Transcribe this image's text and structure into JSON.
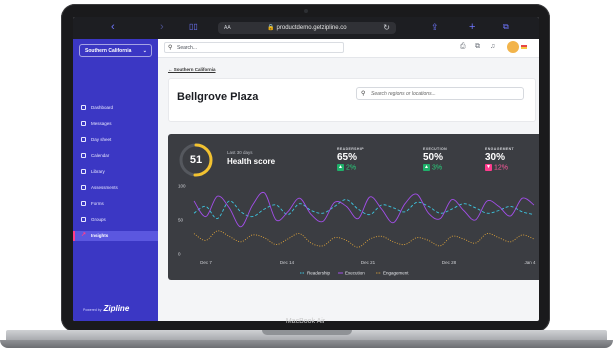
{
  "device": {
    "label": "MacBook Air"
  },
  "browser": {
    "url": "productdemo.getzipline.co",
    "aa": "AA"
  },
  "sidebar": {
    "region": "Southern California",
    "items": [
      {
        "label": "Dashboard",
        "icon": "dashboard-icon"
      },
      {
        "label": "Messages",
        "icon": "messages-icon"
      },
      {
        "label": "Day sheet",
        "icon": "day-sheet-icon"
      },
      {
        "label": "Calendar",
        "icon": "calendar-icon"
      },
      {
        "label": "Library",
        "icon": "library-icon"
      },
      {
        "label": "Assessments",
        "icon": "assessments-icon"
      },
      {
        "label": "Forms",
        "icon": "forms-icon"
      },
      {
        "label": "Groups",
        "icon": "groups-icon"
      },
      {
        "label": "Insights",
        "icon": "insights-icon"
      }
    ],
    "active_item": "Insights",
    "powered_by": "Powered by",
    "brand": "Zipline"
  },
  "toolbar": {
    "search_placeholder": "Search..."
  },
  "breadcrumb": "← Southern California",
  "page": {
    "title": "Bellgrove Plaza",
    "region_search_placeholder": "Search regions or locations..."
  },
  "scorecard": {
    "score": "51",
    "period": "Last 30 days",
    "label": "Health score",
    "score_fraction": 0.51,
    "metrics": [
      {
        "label": "READERSHIP",
        "value": "65%",
        "delta": "2%",
        "direction": "up",
        "color": "#1fb06a"
      },
      {
        "label": "EXECUTION",
        "value": "50%",
        "delta": "3%",
        "direction": "up",
        "color": "#1fb06a"
      },
      {
        "label": "ENGAGEMENT",
        "value": "30%",
        "delta": "12%",
        "direction": "down",
        "color": "#ff3b8d"
      }
    ]
  },
  "chart_data": {
    "type": "line",
    "ylim": [
      0,
      100
    ],
    "y_ticks": [
      "100",
      "50",
      "0"
    ],
    "x_ticks": [
      "Dec 7",
      "Dec 14",
      "Dec 21",
      "Dec 28",
      "Jan 4"
    ],
    "series": [
      {
        "name": "Readership",
        "color": "#3dc6e0",
        "style": "dashed",
        "values": [
          60,
          70,
          52,
          78,
          62,
          55,
          66,
          72,
          58,
          74,
          64,
          60,
          70,
          80,
          66,
          58,
          72,
          68,
          62,
          76,
          70,
          60,
          66,
          74,
          68,
          60,
          64,
          70,
          62,
          58
        ]
      },
      {
        "name": "Execution",
        "color": "#a24ee8",
        "style": "solid",
        "values": [
          78,
          55,
          85,
          68,
          40,
          72,
          90,
          50,
          62,
          82,
          58,
          48,
          76,
          70,
          52,
          84,
          66,
          46,
          74,
          88,
          60,
          52,
          80,
          64,
          50,
          78,
          70,
          56,
          82,
          72
        ]
      },
      {
        "name": "Engagement",
        "color": "#e0a53a",
        "style": "dotted",
        "values": [
          30,
          20,
          34,
          26,
          18,
          28,
          24,
          14,
          22,
          30,
          16,
          12,
          24,
          20,
          10,
          22,
          26,
          18,
          14,
          24,
          20,
          12,
          26,
          22,
          16,
          30,
          24,
          18,
          28,
          22
        ]
      }
    ],
    "legend_position": "bottom"
  }
}
